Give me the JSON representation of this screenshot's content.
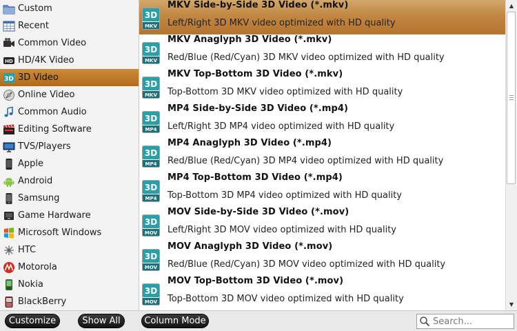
{
  "sidebar": {
    "items": [
      {
        "label": "Custom",
        "icon": "folder-icon"
      },
      {
        "label": "Recent",
        "icon": "recent-grid-icon"
      },
      {
        "label": "Common Video",
        "icon": "video-camera-icon"
      },
      {
        "label": "HD/4K Video",
        "icon": "hd-icon"
      },
      {
        "label": "3D Video",
        "icon": "3d-icon",
        "selected": true
      },
      {
        "label": "Online Video",
        "icon": "online-video-icon"
      },
      {
        "label": "Common Audio",
        "icon": "music-note-icon"
      },
      {
        "label": "Editing Software",
        "icon": "clapperboard-icon"
      },
      {
        "label": "TVS/Players",
        "icon": "tv-icon"
      },
      {
        "label": "Apple",
        "icon": "iphone-icon"
      },
      {
        "label": "Android",
        "icon": "android-icon"
      },
      {
        "label": "Samsung",
        "icon": "samsung-phone-icon"
      },
      {
        "label": "Game Hardware",
        "icon": "game-console-icon"
      },
      {
        "label": "Microsoft Windows",
        "icon": "windows-logo-icon"
      },
      {
        "label": "HTC",
        "icon": "htc-icon"
      },
      {
        "label": "Motorola",
        "icon": "motorola-logo-icon"
      },
      {
        "label": "Nokia",
        "icon": "nokia-phone-icon"
      },
      {
        "label": "BlackBerry",
        "icon": "blackberry-phone-icon"
      }
    ]
  },
  "formats": {
    "items": [
      {
        "title": "MKV Side-by-Side 3D Video (*.mkv)",
        "desc": "Left/Right 3D MKV video optimized with HD quality",
        "badge": "MKV",
        "selected": true
      },
      {
        "title": "MKV Anaglyph 3D Video (*.mkv)",
        "desc": "Red/Blue (Red/Cyan) 3D MKV video optimized with HD quality",
        "badge": "MKV"
      },
      {
        "title": "MKV Top-Bottom 3D Video (*.mkv)",
        "desc": "Top-Bottom 3D MKV video optimized with HD quality",
        "badge": "MKV"
      },
      {
        "title": "MP4 Side-by-Side 3D Video (*.mp4)",
        "desc": "Left/Right 3D MP4 video optimized with HD quality",
        "badge": "MP4"
      },
      {
        "title": "MP4 Anaglyph 3D Video (*.mp4)",
        "desc": "Red/Blue (Red/Cyan) 3D MP4 video optimized with HD quality",
        "badge": "MP4"
      },
      {
        "title": "MP4 Top-Bottom 3D Video (*.mp4)",
        "desc": "Top-Bottom 3D MP4 video optimized with HD quality",
        "badge": "MP4"
      },
      {
        "title": "MOV Side-by-Side 3D Video (*.mov)",
        "desc": "Left/Right 3D MOV video optimized with HD quality",
        "badge": "MOV"
      },
      {
        "title": "MOV Anaglyph 3D Video (*.mov)",
        "desc": "Red/Blue (Red/Cyan) 3D MOV video optimized with HD quality",
        "badge": "MOV"
      },
      {
        "title": "MOV Top-Bottom 3D Video (*.mov)",
        "desc": "Top-Bottom 3D MOV video optimized with HD quality",
        "badge": "MOV"
      }
    ]
  },
  "badge_text_3d": "3D",
  "bottombar": {
    "customize_label": "Customize",
    "show_all_label": "Show All",
    "column_mode_label": "Column Mode",
    "search_placeholder": "Search..."
  },
  "colors": {
    "selection": "#c0833d",
    "badge_teal": "#2a9fa8",
    "pill_bg": "#1e1e1e"
  }
}
